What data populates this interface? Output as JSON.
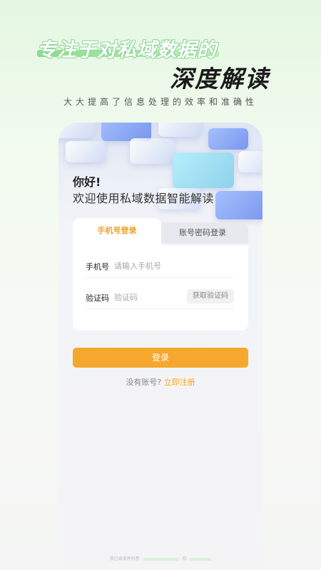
{
  "hero": {
    "line1": "专注于对私域数据的",
    "line2": "深度解读",
    "subtitle": "大大提高了信息处理的效率和准确性"
  },
  "greeting": {
    "title": "你好!",
    "subtitle": "欢迎使用私域数据智能解读"
  },
  "tabs": {
    "phone_login": "手机号登录",
    "password_login": "账号密码登录"
  },
  "form": {
    "phone_label": "手机号",
    "phone_placeholder": "请输入手机号",
    "code_label": "验证码",
    "code_placeholder": "验证码",
    "get_code": "获取验证码"
  },
  "login_button": "登录",
  "register": {
    "prompt": "没有账号?",
    "link": "立即注册"
  },
  "footer": {
    "text": "我已阅读并同意",
    "and": "和"
  },
  "colors": {
    "accent": "#f6a72d",
    "hero_green": "#7eda83"
  }
}
